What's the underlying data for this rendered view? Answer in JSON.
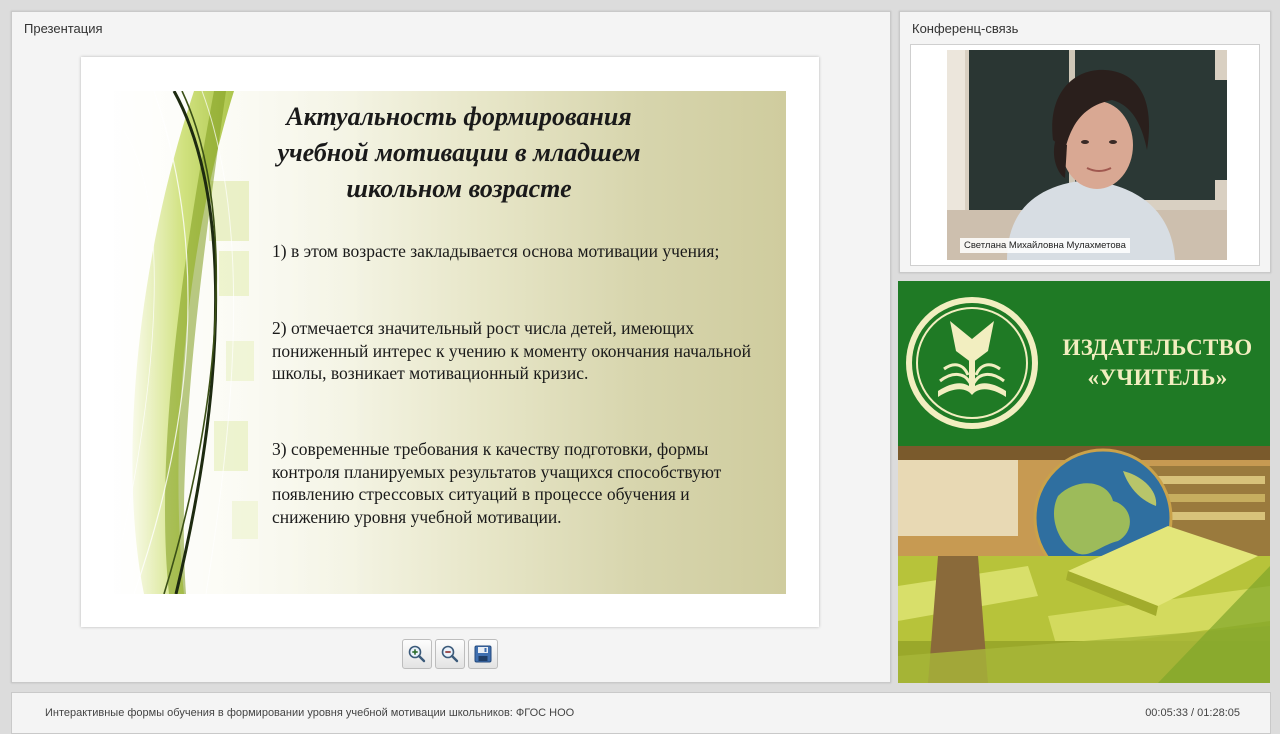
{
  "presentation_panel": {
    "title": "Презентация",
    "slide": {
      "title_lines": [
        "Актуальность формирования",
        "учебной мотивации в младшем",
        "школьном возрасте"
      ],
      "points": [
        "1) в этом возрасте закладывается основа мотивации учения;",
        "2) отмечается значительный рост числа детей, имеющих пониженный интерес к учению к моменту окончания начальной школы, возникает мотивационный кризис.",
        "3) современные требования к качеству подготовки, формы контроля планируемых результатов учащихся способствуют появлению стрессовых ситуаций в процессе обучения и снижению уровня учебной мотивации."
      ]
    },
    "toolbar": {
      "zoom_in_icon": "zoom-in-icon",
      "zoom_out_icon": "zoom-out-icon",
      "save_icon": "floppy-disk-icon"
    }
  },
  "conference_panel": {
    "title": "Конференц-связь",
    "speaker_name": "Светлана Михайловна Мулахметова"
  },
  "banner": {
    "publisher_lines": [
      "ИЗДАТЕЛЬСТВО",
      "«УЧИТЕЛЬ»"
    ],
    "logo_icon": "book-emblem-icon"
  },
  "bottom_bar": {
    "webinar_title": "Интерактивные формы обучения в формировании уровня учебной мотивации школьников: ФГОС НОО",
    "timer": "00:05:33 / 01:28:05"
  },
  "colors": {
    "banner_green": "#1f7a25",
    "publisher_text": "#f2eec0",
    "slide_accent": "#b9d45a"
  }
}
